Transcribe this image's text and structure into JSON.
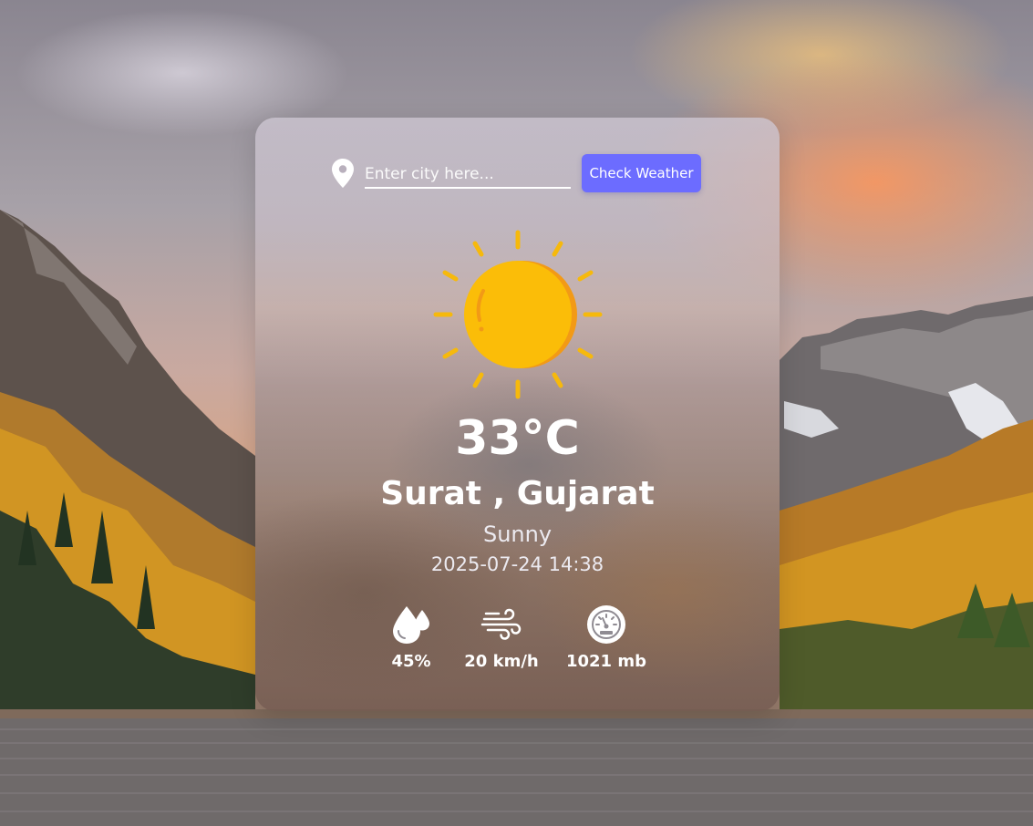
{
  "search": {
    "placeholder": "Enter city here...",
    "value": "",
    "button_label": "Check Weather",
    "button_color": "#6c6cff"
  },
  "weather": {
    "icon": "sun-icon",
    "temperature": "33°C",
    "location": "Surat , Gujarat",
    "condition": "Sunny",
    "datetime": "2025-07-24 14:38"
  },
  "stats": [
    {
      "icon": "humidity-drops-icon",
      "value": "45%"
    },
    {
      "icon": "wind-icon",
      "value": "20 km/h"
    },
    {
      "icon": "pressure-gauge-icon",
      "value": "1021 mb"
    }
  ]
}
